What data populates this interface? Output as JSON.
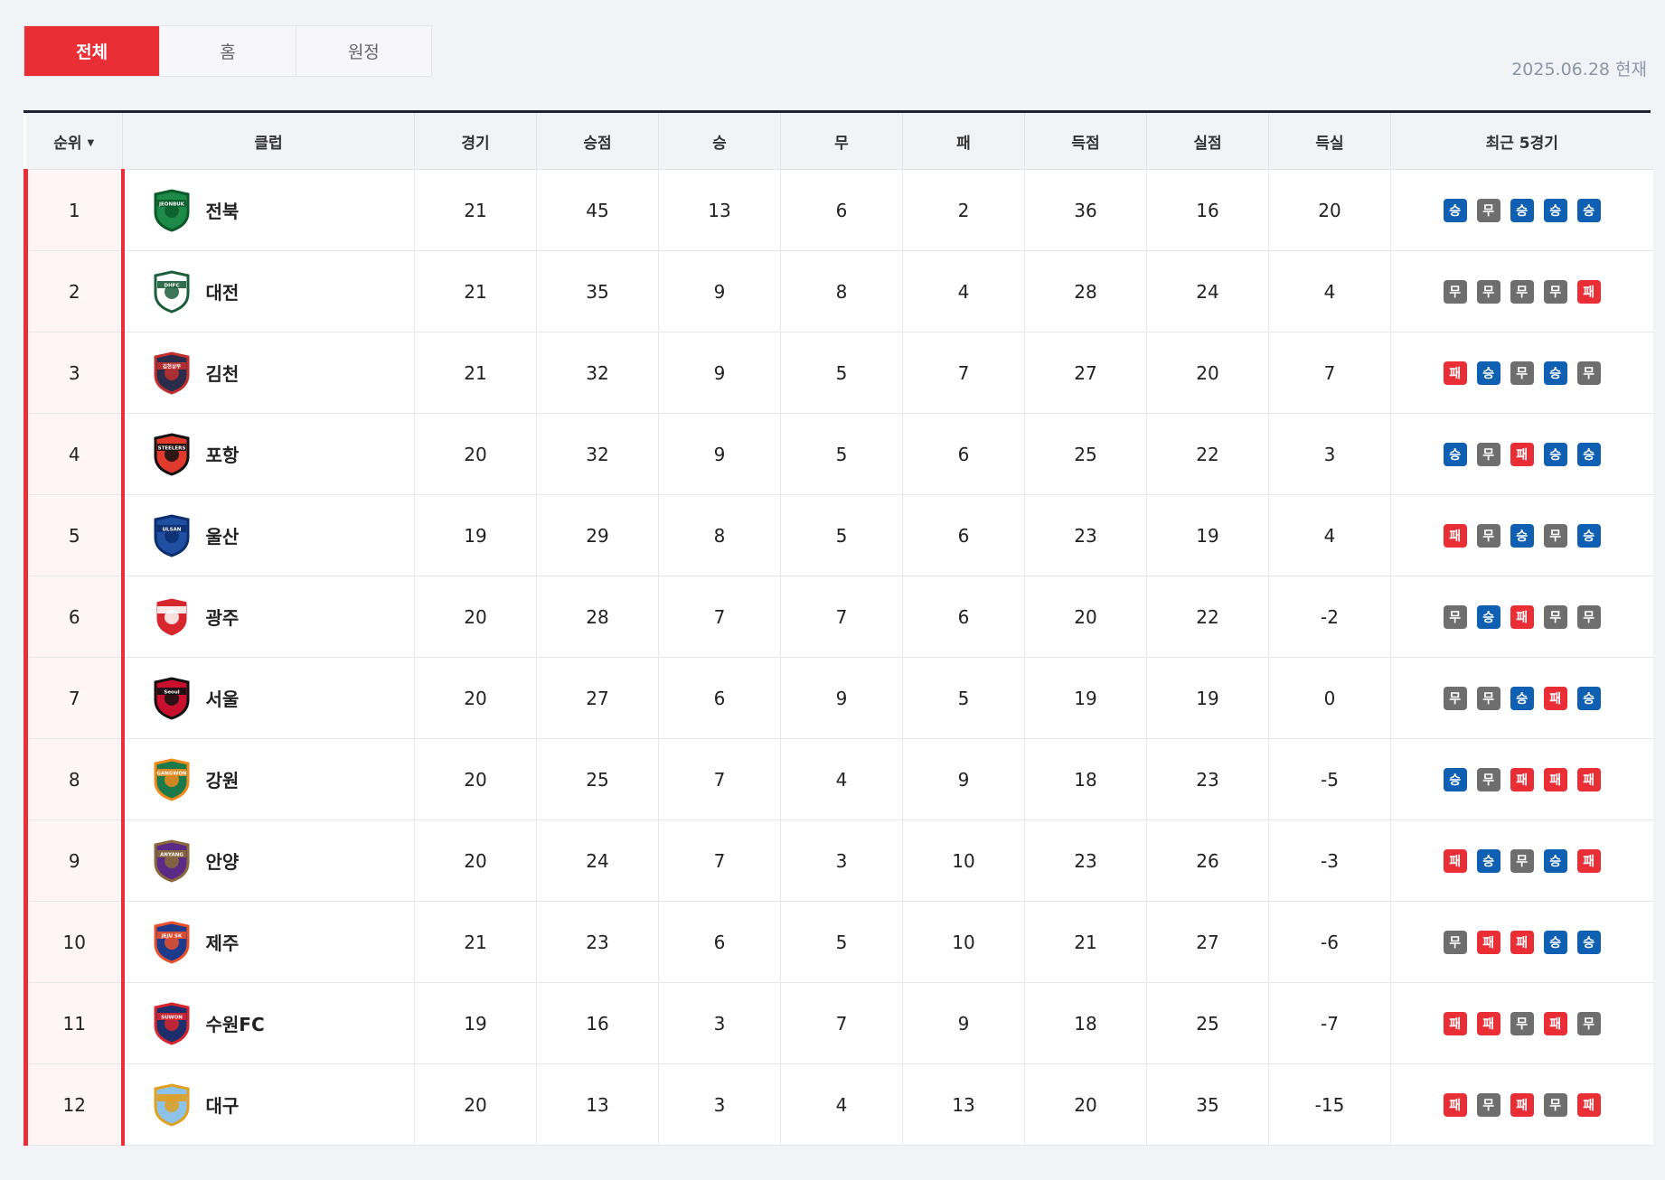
{
  "tabs": [
    {
      "label": "전체",
      "active": true
    },
    {
      "label": "홈",
      "active": false
    },
    {
      "label": "원정",
      "active": false
    }
  ],
  "as_of": "2025.06.28 현재",
  "columns": [
    "순위",
    "클럽",
    "경기",
    "승점",
    "승",
    "무",
    "패",
    "득점",
    "실점",
    "득실",
    "최근 5경기"
  ],
  "sort_icon": "sort-down-icon",
  "colors": {
    "accent": "#ea2e35",
    "win": "#0f5fb3",
    "draw": "#6e6e6e",
    "loss": "#ea2e35"
  },
  "rows": [
    {
      "rank": "1",
      "club": "전북",
      "crest": "jeonbuk-crest-icon",
      "crest_text": "JEONBUK",
      "c1": "#1e8a4a",
      "c2": "#0b5a2a",
      "played": "21",
      "points": "45",
      "w": "13",
      "d": "6",
      "l": "2",
      "gf": "36",
      "ga": "16",
      "gd": "20",
      "form": [
        "승",
        "무",
        "승",
        "승",
        "승"
      ]
    },
    {
      "rank": "2",
      "club": "대전",
      "crest": "daejeon-crest-icon",
      "crest_text": "DHFC",
      "c1": "#ffffff",
      "c2": "#1b5e3b",
      "played": "21",
      "points": "35",
      "w": "9",
      "d": "8",
      "l": "4",
      "gf": "28",
      "ga": "24",
      "gd": "4",
      "form": [
        "무",
        "무",
        "무",
        "무",
        "패"
      ]
    },
    {
      "rank": "3",
      "club": "김천",
      "crest": "gimcheon-crest-icon",
      "crest_text": "김천상무",
      "c1": "#2b2b4a",
      "c2": "#c0302f",
      "played": "21",
      "points": "32",
      "w": "9",
      "d": "5",
      "l": "7",
      "gf": "27",
      "ga": "20",
      "gd": "7",
      "form": [
        "패",
        "승",
        "무",
        "승",
        "무"
      ]
    },
    {
      "rank": "4",
      "club": "포항",
      "crest": "pohang-crest-icon",
      "crest_text": "STEELERS",
      "c1": "#e03a2c",
      "c2": "#111111",
      "played": "20",
      "points": "32",
      "w": "9",
      "d": "5",
      "l": "6",
      "gf": "25",
      "ga": "22",
      "gd": "3",
      "form": [
        "승",
        "무",
        "패",
        "승",
        "승"
      ]
    },
    {
      "rank": "5",
      "club": "울산",
      "crest": "ulsan-crest-icon",
      "crest_text": "ULSAN",
      "c1": "#1f4fa0",
      "c2": "#0d2e6e",
      "played": "19",
      "points": "29",
      "w": "8",
      "d": "5",
      "l": "6",
      "gf": "23",
      "ga": "19",
      "gd": "4",
      "form": [
        "패",
        "무",
        "승",
        "무",
        "승"
      ]
    },
    {
      "rank": "6",
      "club": "광주",
      "crest": "gwangju-crest-icon",
      "crest_text": "",
      "c1": "#d8262f",
      "c2": "#ffffff",
      "played": "20",
      "points": "28",
      "w": "7",
      "d": "7",
      "l": "6",
      "gf": "20",
      "ga": "22",
      "gd": "-2",
      "form": [
        "무",
        "승",
        "패",
        "무",
        "무"
      ]
    },
    {
      "rank": "7",
      "club": "서울",
      "crest": "seoul-crest-icon",
      "crest_text": "Seoul",
      "c1": "#c8102e",
      "c2": "#111111",
      "played": "20",
      "points": "27",
      "w": "6",
      "d": "9",
      "l": "5",
      "gf": "19",
      "ga": "19",
      "gd": "0",
      "form": [
        "무",
        "무",
        "승",
        "패",
        "승"
      ]
    },
    {
      "rank": "8",
      "club": "강원",
      "crest": "gangwon-crest-icon",
      "crest_text": "GANGWON",
      "c1": "#1c7a4a",
      "c2": "#f08a1c",
      "played": "20",
      "points": "25",
      "w": "7",
      "d": "4",
      "l": "9",
      "gf": "18",
      "ga": "23",
      "gd": "-5",
      "form": [
        "승",
        "무",
        "패",
        "패",
        "패"
      ]
    },
    {
      "rank": "9",
      "club": "안양",
      "crest": "anyang-crest-icon",
      "crest_text": "ANYANG",
      "c1": "#5b2a86",
      "c2": "#8a6a3a",
      "played": "20",
      "points": "24",
      "w": "7",
      "d": "3",
      "l": "10",
      "gf": "23",
      "ga": "26",
      "gd": "-3",
      "form": [
        "패",
        "승",
        "무",
        "승",
        "패"
      ]
    },
    {
      "rank": "10",
      "club": "제주",
      "crest": "jeju-crest-icon",
      "crest_text": "JEJU SK",
      "c1": "#1e3a8a",
      "c2": "#e8512b",
      "played": "21",
      "points": "23",
      "w": "6",
      "d": "5",
      "l": "10",
      "gf": "21",
      "ga": "27",
      "gd": "-6",
      "form": [
        "무",
        "패",
        "패",
        "승",
        "승"
      ]
    },
    {
      "rank": "11",
      "club": "수원FC",
      "crest": "suwonfc-crest-icon",
      "crest_text": "SUWON",
      "c1": "#1d2f6b",
      "c2": "#d8262f",
      "played": "19",
      "points": "16",
      "w": "3",
      "d": "7",
      "l": "9",
      "gf": "18",
      "ga": "25",
      "gd": "-7",
      "form": [
        "패",
        "패",
        "무",
        "패",
        "무"
      ]
    },
    {
      "rank": "12",
      "club": "대구",
      "crest": "daegu-crest-icon",
      "crest_text": "",
      "c1": "#8dc3e8",
      "c2": "#e0a020",
      "played": "20",
      "points": "13",
      "w": "3",
      "d": "4",
      "l": "13",
      "gf": "20",
      "ga": "35",
      "gd": "-15",
      "form": [
        "패",
        "무",
        "패",
        "무",
        "패"
      ]
    }
  ]
}
